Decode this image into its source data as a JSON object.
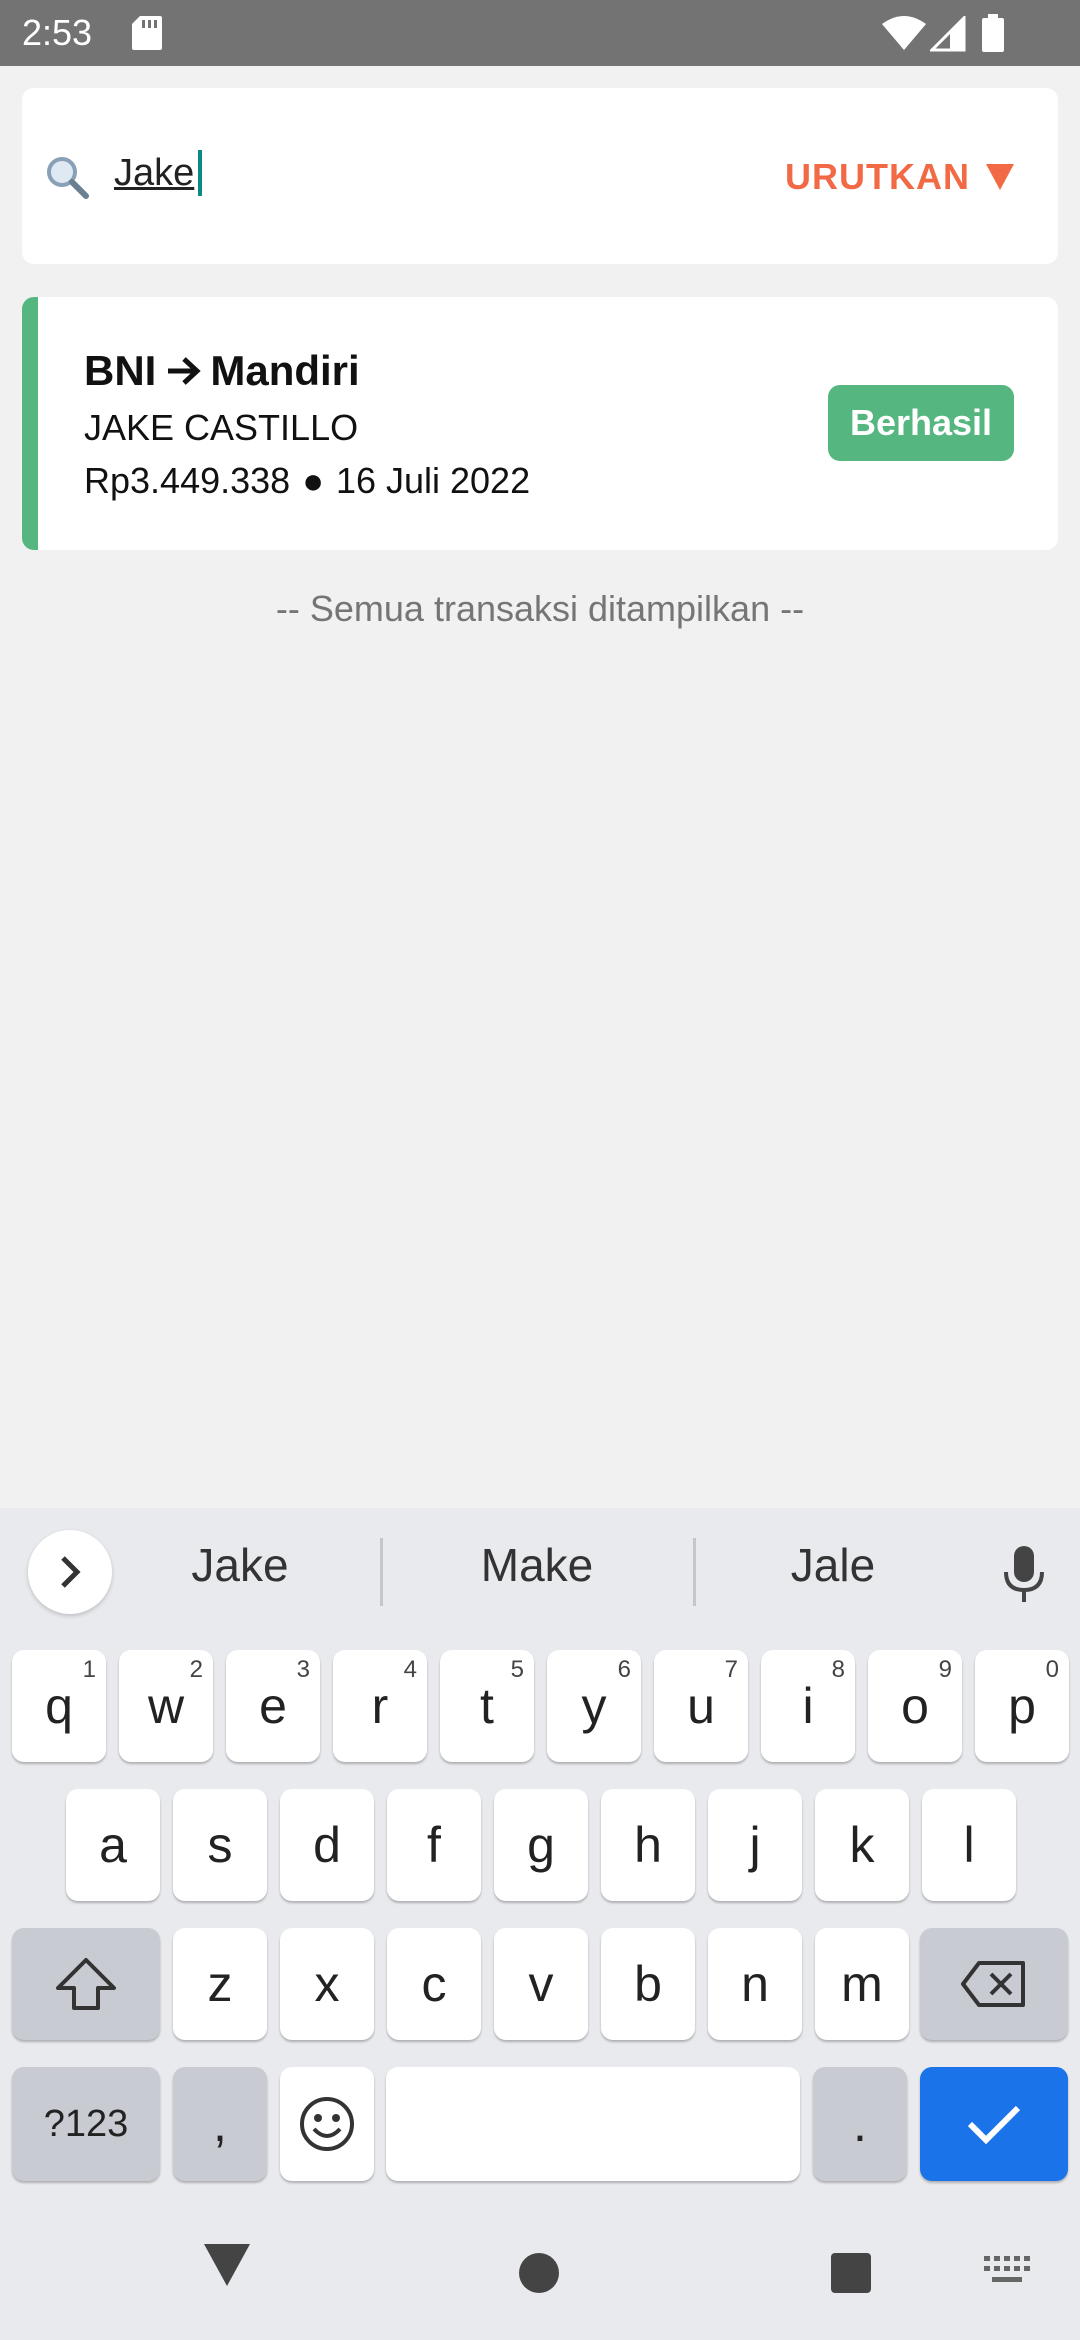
{
  "status_bar": {
    "time": "2:53"
  },
  "search": {
    "value": "Jake",
    "sort_label": "URUTKAN"
  },
  "transactions": [
    {
      "from_bank": "BNI",
      "to_bank": "Mandiri",
      "name": "JAKE CASTILLO",
      "amount": "Rp3.449.338",
      "separator": "●",
      "date": "16 Juli 2022",
      "status": "Berhasil"
    }
  ],
  "end_note": "-- Semua transaksi ditampilkan --",
  "keyboard": {
    "suggestions": [
      "Jake",
      "Make",
      "Jale"
    ],
    "row1": [
      {
        "key": "q",
        "hint": "1"
      },
      {
        "key": "w",
        "hint": "2"
      },
      {
        "key": "e",
        "hint": "3"
      },
      {
        "key": "r",
        "hint": "4"
      },
      {
        "key": "t",
        "hint": "5"
      },
      {
        "key": "y",
        "hint": "6"
      },
      {
        "key": "u",
        "hint": "7"
      },
      {
        "key": "i",
        "hint": "8"
      },
      {
        "key": "o",
        "hint": "9"
      },
      {
        "key": "p",
        "hint": "0"
      }
    ],
    "row2": [
      "a",
      "s",
      "d",
      "f",
      "g",
      "h",
      "j",
      "k",
      "l"
    ],
    "row3": [
      "z",
      "x",
      "c",
      "v",
      "b",
      "n",
      "m"
    ],
    "symbols_label": "?123",
    "comma": ",",
    "period": "."
  },
  "colors": {
    "accent_sort": "#f26a45",
    "success": "#55b67f",
    "enter_key": "#1a73e8"
  }
}
